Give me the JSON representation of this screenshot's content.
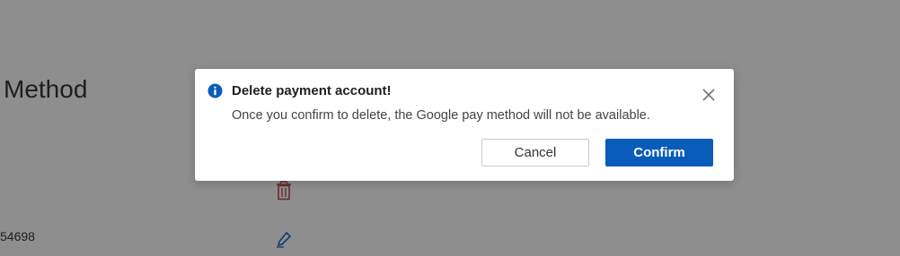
{
  "background": {
    "page_title": "Method",
    "account_number": "54698",
    "delete_icon": "trash-icon",
    "edit_icon": "pencil-icon"
  },
  "dialog": {
    "icon": "info-icon",
    "title": "Delete payment account!",
    "message": "Once you confirm to delete, the Google pay method will not be available.",
    "close_icon": "close-icon",
    "cancel_label": "Cancel",
    "confirm_label": "Confirm"
  },
  "colors": {
    "accent": "#0a5cba",
    "overlay": "#8c8c8c",
    "delete_icon": "#b03a3a"
  }
}
